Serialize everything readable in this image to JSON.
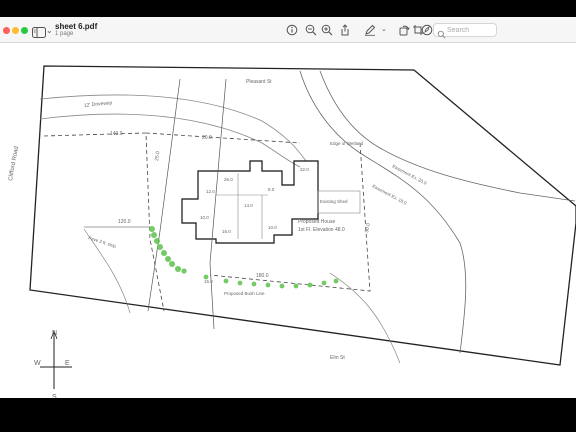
{
  "window": {
    "title": "sheet 6.pdf",
    "subtitle": "1 page"
  },
  "toolbar": {
    "search": {
      "placeholder": "Search",
      "value": ""
    }
  },
  "colors": {
    "close": "#ff5f57",
    "minimize": "#febc2e",
    "maximize": "#28c840",
    "landscaping": "#5cc24a",
    "toolbar_bg": "#f6f6f6",
    "letterbox": "#000000"
  },
  "plan": {
    "top_street": "Pleasant St",
    "driveway": "12' Driveway",
    "left_road": "Clifford Road",
    "bottom_street": "Elm St",
    "proposed_house": "Proposed House",
    "first_floor_elev": "1st Fl. Elevation 48.0",
    "easement_1": "Easement Ex. 20.0",
    "easement_2": "Easement Ex. 18.0",
    "existing_shed": "Existing Shed",
    "edge_of_wetland": "Edge of Wetland",
    "proposed_bush_line": "Proposed Bush Line",
    "dim_left": "120.0",
    "dim_bottom": "180.0",
    "dim_top_left": "140.0",
    "setback_top": "20.0",
    "setback_right": "30.0",
    "setback_left": "25.0",
    "setback_bottom": "15.0",
    "paving_note": "Pave 2 ft. strip",
    "room_labels": [
      "26.0",
      "12.0",
      "14.0",
      "8.0",
      "22.0",
      "16.0",
      "10.0",
      "10.0"
    ]
  },
  "compass": {
    "north": "N",
    "south": "S",
    "east": "E",
    "west": "W"
  },
  "icons": [
    "sidebar-icon",
    "info-icon",
    "zoom-out-icon",
    "zoom-in-icon",
    "share-icon",
    "markup-icon",
    "rotate-icon",
    "crop-icon",
    "highlight-icon",
    "search-icon"
  ]
}
